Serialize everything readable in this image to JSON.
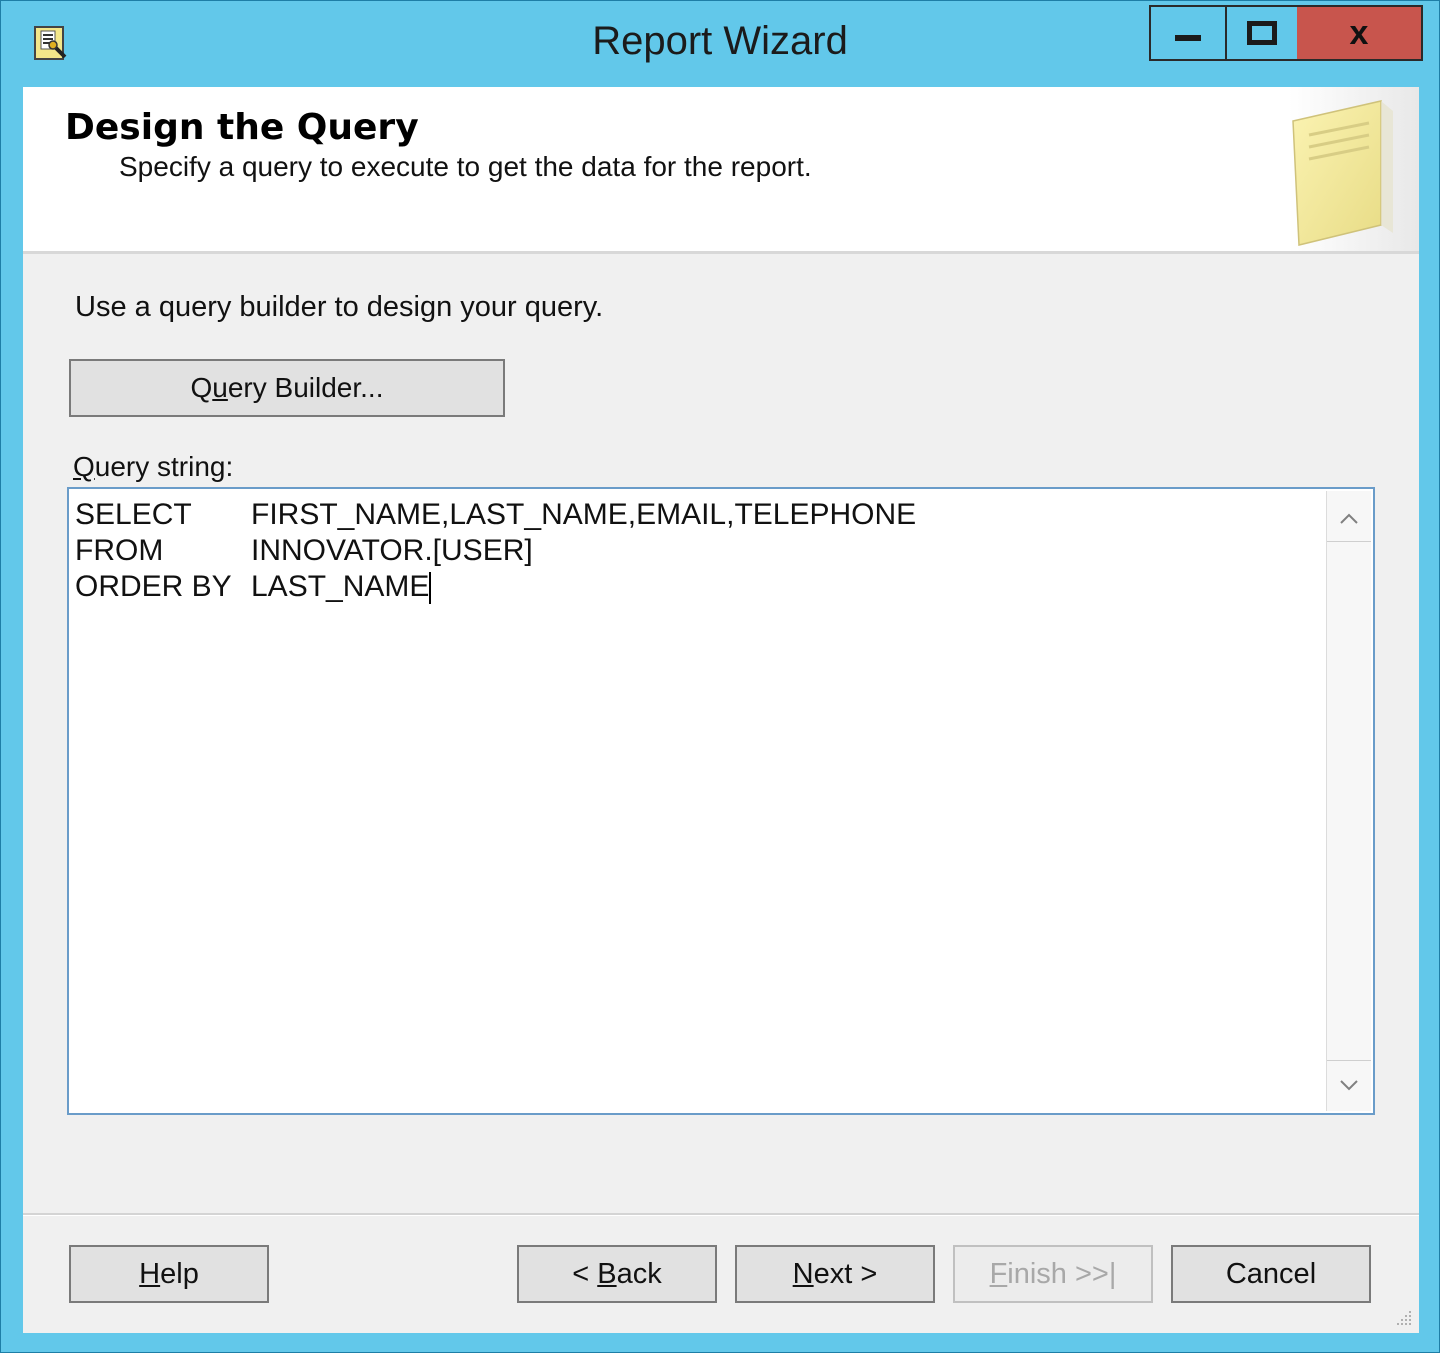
{
  "window": {
    "title": "Report Wizard",
    "close_glyph": "x"
  },
  "header": {
    "title": "Design the Query",
    "subtitle": "Specify a query to execute to get the data for the report."
  },
  "body": {
    "instruction": "Use a query builder to design your query.",
    "query_builder_button": {
      "pre": "Q",
      "mnemonic": "u",
      "post": "ery Builder..."
    },
    "query_string_label": {
      "mnemonic": "Q",
      "post": "uery string:"
    },
    "query_lines": [
      {
        "keyword": "SELECT",
        "value": "FIRST_NAME,LAST_NAME,EMAIL,TELEPHONE"
      },
      {
        "keyword": "FROM",
        "value": "INNOVATOR.[USER]"
      },
      {
        "keyword": "ORDER BY",
        "value": "LAST_NAME"
      }
    ]
  },
  "footer": {
    "help": {
      "mnemonic": "H",
      "post": "elp"
    },
    "back": {
      "pre": "< ",
      "mnemonic": "B",
      "post": "ack"
    },
    "next": {
      "mnemonic": "N",
      "post": "ext >"
    },
    "finish": {
      "mnemonic": "F",
      "post": "inish >>|"
    },
    "cancel": "Cancel"
  },
  "icons": {
    "app": "report-wizard-icon",
    "header": "document-icon",
    "scroll_up": "chevron-up-icon",
    "scroll_down": "chevron-down-icon",
    "grip": "resize-grip-icon"
  },
  "colors": {
    "titlebar": "#62c8ea",
    "close_button": "#c8554d",
    "client_background": "#f0f0f0",
    "query_border": "#6a9cc9"
  }
}
